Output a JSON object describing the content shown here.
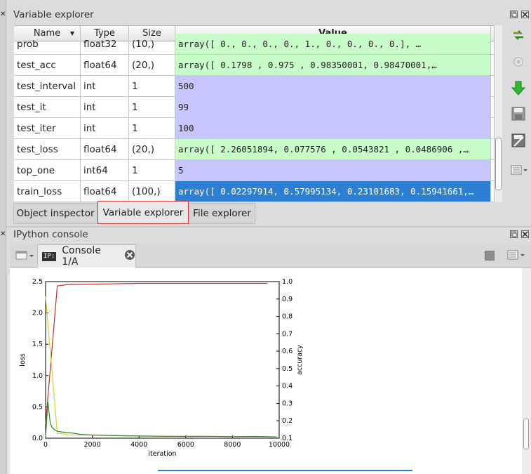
{
  "explorer": {
    "title": "Variable explorer",
    "columns": {
      "name": "Name",
      "type": "Type",
      "size": "Size",
      "value": "Value"
    },
    "rows": [
      {
        "name": "prob",
        "type": "float32",
        "size": "(10,)",
        "value": "array([ 0.,  0.,  0.,  0.,  1.,  0.,  0.,  0.,  0.], …",
        "color": "green"
      },
      {
        "name": "test_acc",
        "type": "float64",
        "size": "(20,)",
        "value": "array([ 0.1798    ,  0.975     ,  0.98350001,  0.98470001,…",
        "color": "green"
      },
      {
        "name": "test_interval",
        "type": "int",
        "size": "1",
        "value": "500",
        "color": "blue"
      },
      {
        "name": "test_it",
        "type": "int",
        "size": "1",
        "value": "99",
        "color": "blue"
      },
      {
        "name": "test_iter",
        "type": "int",
        "size": "1",
        "value": "100",
        "color": "blue"
      },
      {
        "name": "test_loss",
        "type": "float64",
        "size": "(20,)",
        "value": "array([ 2.26051894,  0.077576  ,  0.0543821 ,  0.0486906 ,…",
        "color": "green"
      },
      {
        "name": "top_one",
        "type": "int64",
        "size": "1",
        "value": "5",
        "color": "blue"
      },
      {
        "name": "train_loss",
        "type": "float64",
        "size": "(100,)",
        "value": "array([ 0.02297914,  0.57995134,  0.23101683,  0.15941661,…",
        "color": "selected"
      }
    ]
  },
  "tabs": {
    "object_inspector": "Object inspector",
    "variable_explorer": "Variable explorer",
    "file_explorer": "File explorer"
  },
  "console": {
    "title": "IPython console",
    "tab_label": "Console 1/A",
    "tab_badge": "IP:"
  },
  "colors": {
    "green_cell": "#c8fcc8",
    "blue_cell": "#c6c6fc",
    "selected": "#2d7fd4",
    "red_line": "#c03030",
    "yellow_line": "#d8d030",
    "green_line": "#2a8a2a"
  },
  "chart_data": {
    "type": "line",
    "xlabel": "iteration",
    "ylabel": "loss",
    "y2label": "accuracy",
    "xlim": [
      0,
      10000
    ],
    "ylim": [
      0,
      2.5
    ],
    "y2lim": [
      0.1,
      1.0
    ],
    "xticks": [
      "0",
      "2000",
      "4000",
      "6000",
      "8000",
      "10000"
    ],
    "yticks": [
      "0.0",
      "0.5",
      "1.0",
      "1.5",
      "2.0",
      "2.5"
    ],
    "y2ticks": [
      "0.1",
      "0.2",
      "0.3",
      "0.4",
      "0.5",
      "0.6",
      "0.7",
      "0.8",
      "0.9",
      "1.0"
    ],
    "grid": false,
    "series": [
      {
        "axis": "y2",
        "color": "#c03030",
        "x": [
          0,
          500,
          1000,
          2000,
          4000,
          6000,
          8000,
          9500
        ],
        "y": [
          0.18,
          0.975,
          0.984,
          0.985,
          0.99,
          0.99,
          0.99,
          0.99
        ]
      },
      {
        "axis": "y",
        "color": "#d8d030",
        "x": [
          0,
          500,
          1000,
          2000,
          4000,
          6000,
          8000,
          9500
        ],
        "y": [
          2.26,
          0.078,
          0.054,
          0.049,
          0.035,
          0.03,
          0.028,
          0.025
        ]
      },
      {
        "axis": "y",
        "color": "#2a8a2a",
        "x": [
          0,
          100,
          200,
          300,
          400,
          500,
          700,
          900,
          1200,
          1500,
          2000,
          3000,
          4000,
          5000,
          6000,
          7000,
          8000,
          9000,
          9900
        ],
        "y": [
          0.02,
          0.58,
          0.23,
          0.16,
          0.13,
          0.11,
          0.1,
          0.09,
          0.08,
          0.06,
          0.05,
          0.04,
          0.035,
          0.03,
          0.028,
          0.03,
          0.025,
          0.028,
          0.02
        ]
      }
    ]
  }
}
